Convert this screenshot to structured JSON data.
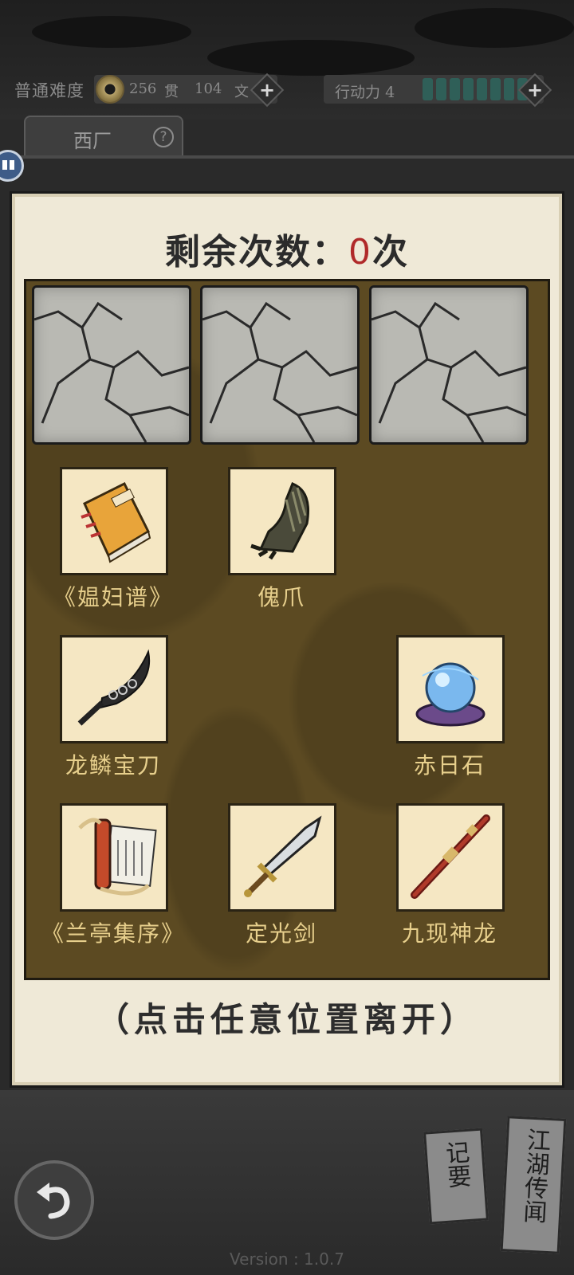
{
  "status": {
    "difficulty": "普通难度",
    "guan_value": "256",
    "guan_unit": "贯",
    "wen_value": "104",
    "wen_unit": "文",
    "action_label": "行动力",
    "action_value": "4",
    "action_segments": 8
  },
  "tab": {
    "label": "西厂",
    "help_symbol": "?"
  },
  "modal": {
    "remaining_label": "剩余次数：",
    "remaining_count": "0",
    "remaining_unit": "次",
    "leave_hint": "（点击任意位置离开）"
  },
  "items": [
    {
      "label": "《媪妇谱》",
      "icon": "book-icon"
    },
    {
      "label": "傀爪",
      "icon": "claw-gauntlet-icon"
    },
    {
      "label": "龙鳞宝刀",
      "icon": "saber-icon"
    },
    {
      "label": "赤日石",
      "icon": "crystal-orb-icon"
    },
    {
      "label": "《兰亭集序》",
      "icon": "scroll-icon"
    },
    {
      "label": "定光剑",
      "icon": "sword-icon"
    },
    {
      "label": "九现神龙",
      "icon": "staff-icon"
    }
  ],
  "bottom": {
    "notes_card": "记要",
    "rumors_card": "江湖传闻",
    "version": "Version : 1.0.7"
  }
}
